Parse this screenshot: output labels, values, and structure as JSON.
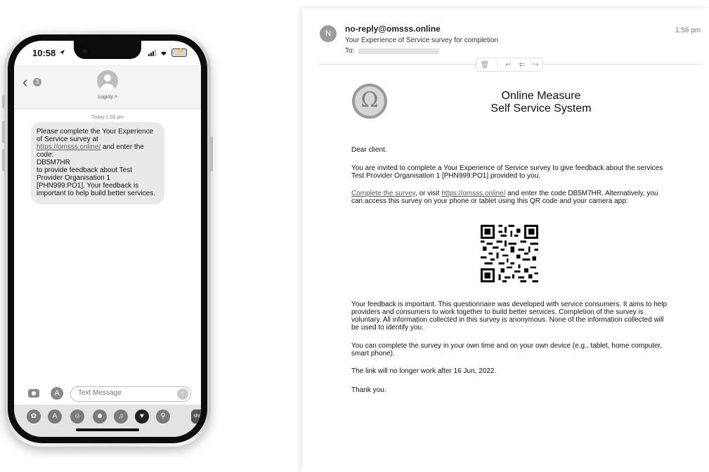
{
  "phone": {
    "status_time": "10:58",
    "back_count": "3",
    "contact_name": "Logicly >",
    "timestamp": "Today 1:58 pm",
    "message": {
      "intro": "Please complete the Your Experience of Service survey at",
      "link": "https://omsss.online/",
      "after_link": "and enter the code:",
      "code": "DB5M7HR",
      "rest": "to provide feedback about Test Provider Organisation 1 [PHN999:PO1]. Your feedback is important to help build better services."
    },
    "input_placeholder": "Text Message",
    "tray_shop_label": "shop"
  },
  "email": {
    "sender_initial": "N",
    "sender": "no-reply@omsss.online",
    "subject": "Your Experience of Service survey for completion",
    "to_label": "To:",
    "time": "1:58 pm",
    "logo_symbol": "Ω",
    "brand_line1": "Online Measure",
    "brand_line2": "Self Service System",
    "greeting": "Dear client.",
    "para1": "You are invited to complete a Your Experience of Service survey to give feedback about the services Test Provider Organisation 1 [PHN999:PO1] provided to you.",
    "para2_link1": "Complete the survey",
    "para2_mid": ", or visit",
    "para2_link2": "https://omsss.online/",
    "para2_rest": "and enter the code DB5M7HR. Alternatively, you can access this survey on your phone or tablet using this QR code and your camera app:",
    "para3": "Your feedback is important. This questionnaire was developed with service consumers. It aims to help providers and consumers to work together to build better services. Completion of the survey is voluntary. All information collected in this survey is anonymous. None of the information collected will be used to identify you.",
    "para4": "You can complete the survey in your own time and on your own device (e.g., tablet, home computer, smart phone).",
    "para5": "The link will no longer work after 16 Jun, 2022.",
    "closing": "Thank you."
  }
}
